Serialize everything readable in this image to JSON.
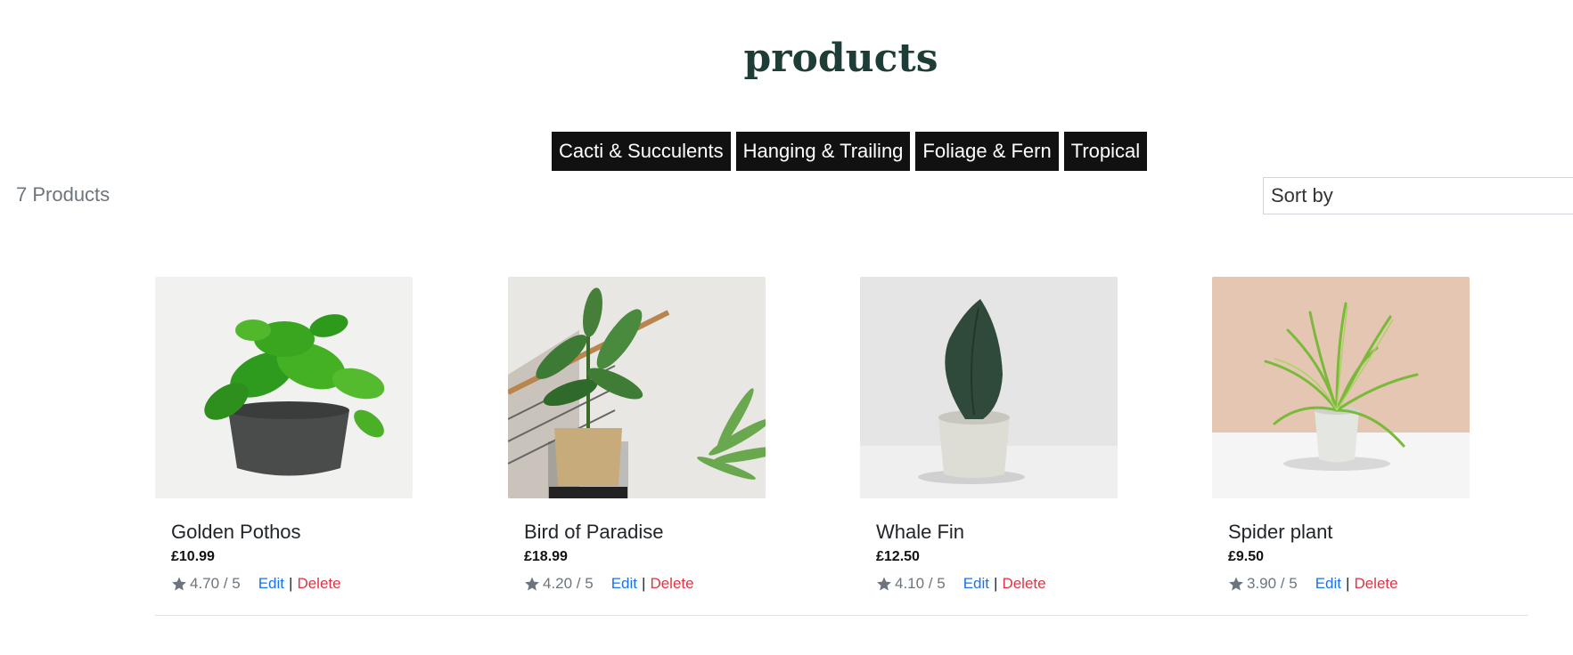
{
  "page": {
    "title": "products"
  },
  "categories": [
    "Cacti & Succulents",
    "Hanging & Trailing",
    "Foliage & Fern",
    "Tropical"
  ],
  "product_count": "7 Products",
  "sort": {
    "label": "Sort by"
  },
  "products": [
    {
      "name": "Golden Pothos",
      "price": "£10.99",
      "rating": "4.70 / 5",
      "edit": "Edit",
      "sep": "|",
      "delete": "Delete"
    },
    {
      "name": "Bird of Paradise",
      "price": "£18.99",
      "rating": "4.20 / 5",
      "edit": "Edit",
      "sep": "|",
      "delete": "Delete"
    },
    {
      "name": "Whale Fin",
      "price": "£12.50",
      "rating": "4.10 / 5",
      "edit": "Edit",
      "sep": "|",
      "delete": "Delete"
    },
    {
      "name": "Spider plant",
      "price": "£9.50",
      "rating": "3.90 / 5",
      "edit": "Edit",
      "sep": "|",
      "delete": "Delete"
    }
  ],
  "colors": {
    "title": "#1e3d36",
    "edit": "#1a73e8",
    "delete": "#dc3545",
    "nav_bg": "#111111"
  }
}
